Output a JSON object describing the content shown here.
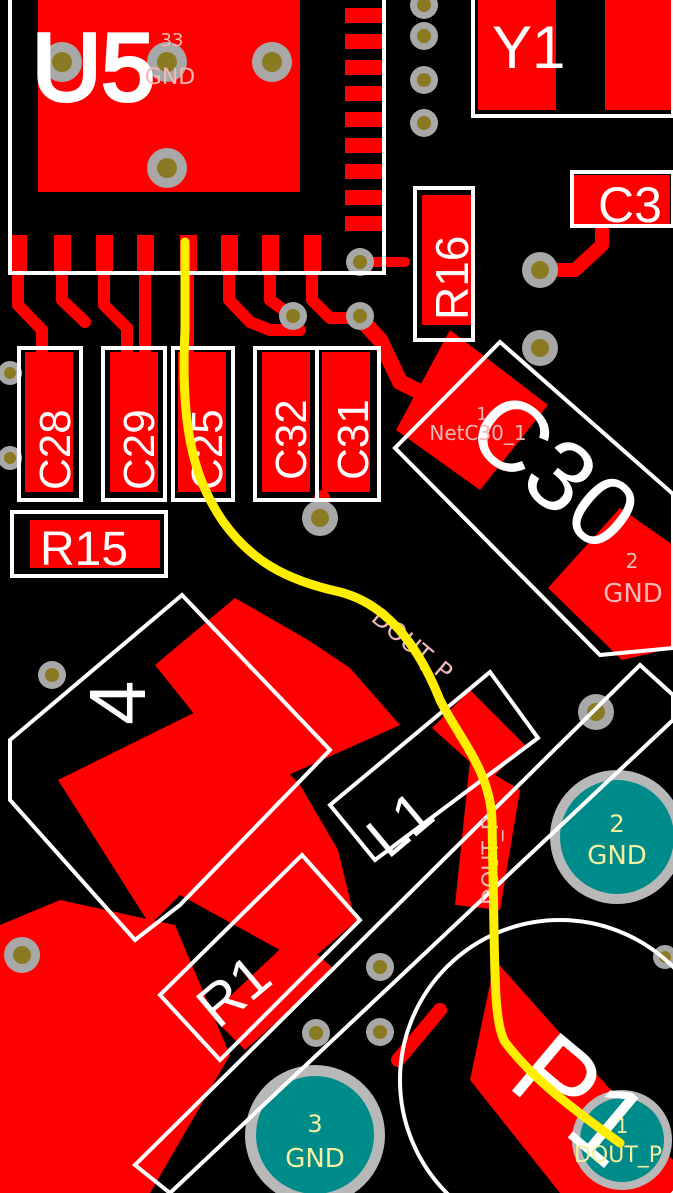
{
  "board": {
    "colors": {
      "background": "#000000",
      "copper": "#ff0000",
      "copper_dark": "#d80000",
      "silkscreen": "#ffffff",
      "via_ring": "#a8a8a8",
      "via_hole": "#8a7a22",
      "pad_fill": "#008b8b",
      "pad_ring": "#b8b8b8",
      "highlight_trace": "#ffee00"
    }
  },
  "components": {
    "u5": {
      "ref": "U5",
      "pad_number": "33",
      "pad_net": "GND"
    },
    "y1": {
      "ref": "Y1"
    },
    "c3": {
      "ref": "C3"
    },
    "r16": {
      "ref": "R16"
    },
    "c28": {
      "ref": "C28"
    },
    "c29": {
      "ref": "C29"
    },
    "c25": {
      "ref": "C25"
    },
    "c32": {
      "ref": "C32"
    },
    "c31": {
      "ref": "C31"
    },
    "c30": {
      "ref": "C30",
      "pad1_number": "1",
      "pad1_net": "NetC30_1",
      "pad2_number": "2",
      "pad2_net": "GND"
    },
    "r15": {
      "ref": "R15"
    },
    "u4": {
      "ref": "4"
    },
    "l1": {
      "ref": "L1"
    },
    "r1": {
      "ref": "R1"
    },
    "p1": {
      "ref": "P1",
      "pad1_number": "1",
      "pad1_net": "DOUT_P",
      "pad2_number": "2",
      "pad2_net": "GND",
      "pad3_number": "3",
      "pad3_net": "GND"
    }
  },
  "nets": {
    "dout_label_a": "DOUT_P",
    "dout_label_b": "DOUT_P"
  }
}
